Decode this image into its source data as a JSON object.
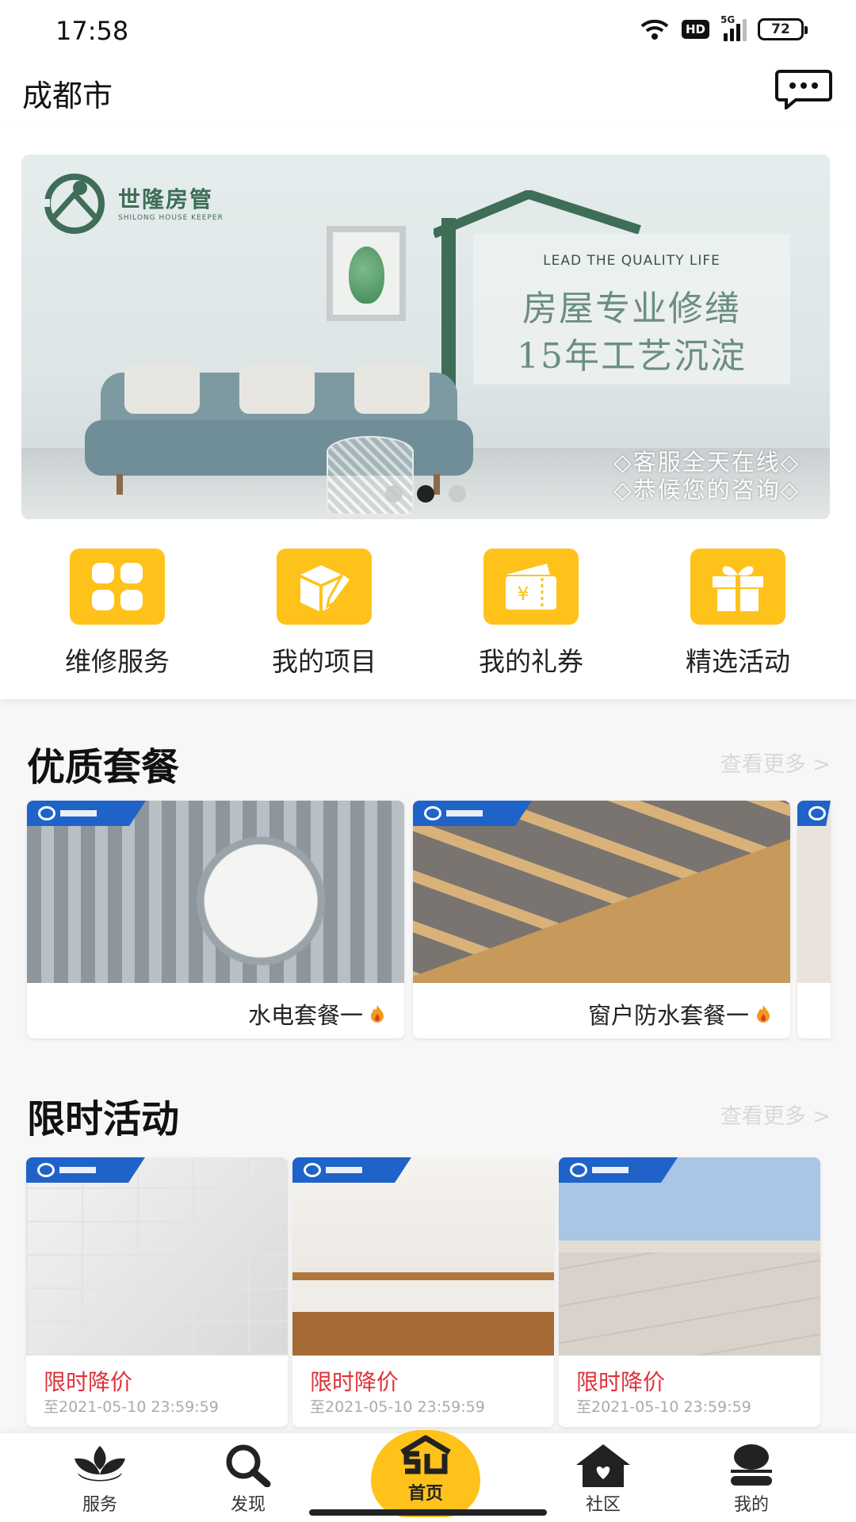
{
  "status_bar": {
    "time": "17:58",
    "network": "HD",
    "signal": "5G",
    "battery": "72"
  },
  "header": {
    "city": "成都市"
  },
  "banner": {
    "logo_name": "世隆房管",
    "logo_sub": "SHILONG HOUSE KEEPER",
    "tagline_en": "LEAD THE QUALITY LIFE",
    "line1": "房屋专业修缮",
    "line2": "15年工艺沉淀",
    "note1": "◇客服全天在线◇",
    "note2": "◇恭候您的咨询◇",
    "slide_count": 3,
    "active_slide": 2
  },
  "quick_menu": [
    {
      "label": "维修服务",
      "icon": "grid-icon"
    },
    {
      "label": "我的项目",
      "icon": "box-edit-icon"
    },
    {
      "label": "我的礼券",
      "icon": "coupon-icon"
    },
    {
      "label": "精选活动",
      "icon": "gift-icon"
    }
  ],
  "packages": {
    "title": "优质套餐",
    "more": "查看更多 >",
    "items": [
      {
        "name": "水电套餐一"
      },
      {
        "name": "窗户防水套餐一"
      }
    ]
  },
  "limited": {
    "title": "限时活动",
    "more": "查看更多 >",
    "items": [
      {
        "label": "限时降价",
        "deadline": "至2021-05-10 23:59:59"
      },
      {
        "label": "限时降价",
        "deadline": "至2021-05-10 23:59:59"
      },
      {
        "label": "限时降价",
        "deadline": "至2021-05-10 23:59:59"
      }
    ]
  },
  "tabbar": {
    "service": "服务",
    "discover": "发现",
    "home": "首页",
    "community": "社区",
    "mine": "我的"
  },
  "colors": {
    "accent": "#ffc21a",
    "price": "#e0323a",
    "brand_blue": "#1f63c9"
  }
}
